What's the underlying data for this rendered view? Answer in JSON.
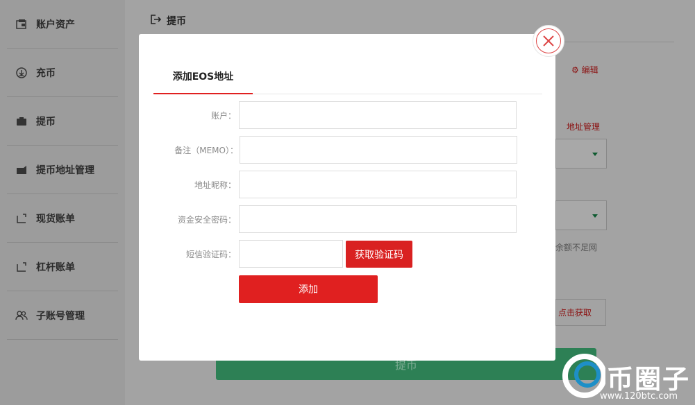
{
  "sidebar": {
    "items": [
      {
        "label": "账户资产",
        "icon": "wallet-icon"
      },
      {
        "label": "充币",
        "icon": "download-icon"
      },
      {
        "label": "提币",
        "icon": "upload-icon"
      },
      {
        "label": "提币地址管理",
        "icon": "address-book-icon"
      },
      {
        "label": "现货账单",
        "icon": "bill-icon"
      },
      {
        "label": "杠杆账单",
        "icon": "bill-icon"
      },
      {
        "label": "子账号管理",
        "icon": "users-icon"
      }
    ]
  },
  "main": {
    "title": "提币",
    "edit_label": "编辑",
    "address_manage_label": "地址管理",
    "balance_note": "余额不足网",
    "fetch_label": "点击获取",
    "submit_label": "提币"
  },
  "modal": {
    "tab_label": "添加EOS地址",
    "fields": {
      "account_label": "账户：",
      "memo_label": "备注（MEMO）：",
      "nickname_label": "地址昵称：",
      "fund_password_label": "资金安全密码：",
      "sms_code_label": "短信验证码："
    },
    "get_code_label": "获取验证码",
    "add_label": "添加"
  },
  "watermark": {
    "text": "币圈子",
    "url": "www.120btc.com"
  },
  "colors": {
    "accent_red": "#e02020",
    "submit_green": "#2d8055",
    "overlay_gray": "#9c9c9c"
  }
}
